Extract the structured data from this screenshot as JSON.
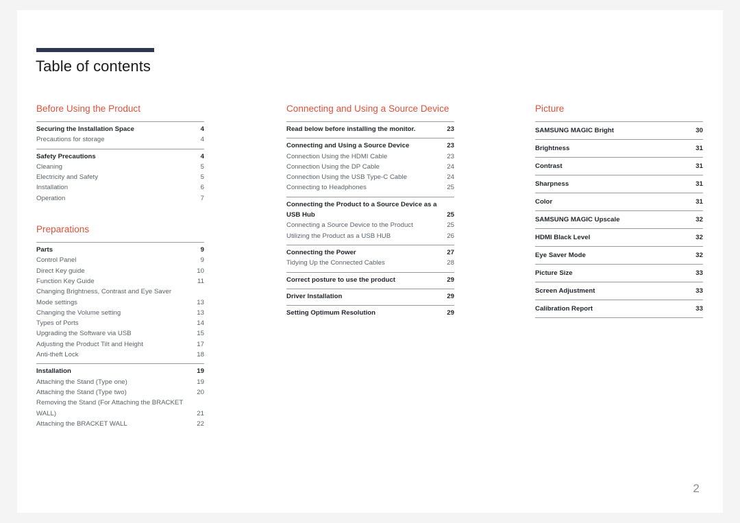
{
  "document": {
    "title": "Table of contents",
    "folio": "2",
    "accent_color": "#e0503a",
    "rule_color": "#2e3650"
  },
  "columns": [
    {
      "name": "column-left",
      "sections": [
        {
          "heading": "Before Using the Product",
          "groups": [
            {
              "entries": [
                {
                  "label": "Securing the Installation Space",
                  "page": "4",
                  "level": "main"
                },
                {
                  "label": "Precautions for storage",
                  "page": "4",
                  "level": "sub"
                }
              ]
            },
            {
              "entries": [
                {
                  "label": "Safety Precautions",
                  "page": "4",
                  "level": "main"
                },
                {
                  "label": "Cleaning",
                  "page": "5",
                  "level": "sub"
                },
                {
                  "label": "Electricity and Safety",
                  "page": "5",
                  "level": "sub"
                },
                {
                  "label": "Installation",
                  "page": "6",
                  "level": "sub"
                },
                {
                  "label": "Operation",
                  "page": "7",
                  "level": "sub"
                }
              ]
            }
          ]
        },
        {
          "heading": "Preparations",
          "groups": [
            {
              "entries": [
                {
                  "label": "Parts",
                  "page": "9",
                  "level": "main"
                },
                {
                  "label": "Control Panel",
                  "page": "9",
                  "level": "sub"
                },
                {
                  "label": "Direct Key guide",
                  "page": "10",
                  "level": "sub"
                },
                {
                  "label": "Function Key Guide",
                  "page": "11",
                  "level": "sub"
                },
                {
                  "label": "Changing Brightness, Contrast and Eye Saver Mode settings",
                  "page": "13",
                  "level": "sub"
                },
                {
                  "label": "Changing the Volume setting",
                  "page": "13",
                  "level": "sub"
                },
                {
                  "label": "Types of Ports",
                  "page": "14",
                  "level": "sub"
                },
                {
                  "label": "Upgrading the Software via USB",
                  "page": "15",
                  "level": "sub"
                },
                {
                  "label": "Adjusting the Product Tilt and Height",
                  "page": "17",
                  "level": "sub"
                },
                {
                  "label": "Anti-theft Lock",
                  "page": "18",
                  "level": "sub"
                }
              ]
            },
            {
              "entries": [
                {
                  "label": "Installation",
                  "page": "19",
                  "level": "main"
                },
                {
                  "label": "Attaching the Stand (Type one)",
                  "page": "19",
                  "level": "sub"
                },
                {
                  "label": "Attaching the Stand (Type two)",
                  "page": "20",
                  "level": "sub"
                },
                {
                  "label": "Removing the Stand (For Attaching the BRACKET WALL)",
                  "page": "21",
                  "level": "sub"
                },
                {
                  "label": "Attaching the BRACKET WALL",
                  "page": "22",
                  "level": "sub"
                }
              ]
            }
          ]
        }
      ]
    },
    {
      "name": "column-middle",
      "sections": [
        {
          "heading": "Connecting and Using a Source Device",
          "groups": [
            {
              "entries": [
                {
                  "label": "Read below before installing the monitor.",
                  "page": "23",
                  "level": "main"
                }
              ]
            },
            {
              "entries": [
                {
                  "label": "Connecting and Using a Source Device",
                  "page": "23",
                  "level": "main"
                },
                {
                  "label": "Connection Using the HDMI Cable",
                  "page": "23",
                  "level": "sub"
                },
                {
                  "label": "Connection Using the DP Cable",
                  "page": "24",
                  "level": "sub"
                },
                {
                  "label": "Connection Using the USB Type-C Cable",
                  "page": "24",
                  "level": "sub"
                },
                {
                  "label": "Connecting to Headphones",
                  "page": "25",
                  "level": "sub"
                }
              ]
            },
            {
              "entries": [
                {
                  "label": "Connecting the Product to a Source Device as a USB Hub",
                  "page": "25",
                  "level": "main"
                },
                {
                  "label": "Connecting a Source Device to the Product",
                  "page": "25",
                  "level": "sub"
                },
                {
                  "label": "Utilizing the Product as a USB HUB",
                  "page": "26",
                  "level": "sub"
                }
              ]
            },
            {
              "entries": [
                {
                  "label": "Connecting the Power",
                  "page": "27",
                  "level": "main"
                },
                {
                  "label": "Tidying Up the Connected Cables",
                  "page": "28",
                  "level": "sub"
                }
              ]
            },
            {
              "entries": [
                {
                  "label": "Correct posture to use the product",
                  "page": "29",
                  "level": "main"
                }
              ]
            },
            {
              "entries": [
                {
                  "label": "Driver Installation",
                  "page": "29",
                  "level": "main"
                }
              ]
            },
            {
              "entries": [
                {
                  "label": "Setting Optimum Resolution",
                  "page": "29",
                  "level": "main"
                }
              ]
            }
          ]
        }
      ]
    },
    {
      "name": "column-right",
      "sections": [
        {
          "heading": "Picture",
          "groups": [
            {
              "entries": [
                {
                  "label": "SAMSUNG MAGIC Bright",
                  "page": "30",
                  "level": "main"
                }
              ]
            },
            {
              "entries": [
                {
                  "label": "Brightness",
                  "page": "31",
                  "level": "main"
                }
              ]
            },
            {
              "entries": [
                {
                  "label": "Contrast",
                  "page": "31",
                  "level": "main"
                }
              ]
            },
            {
              "entries": [
                {
                  "label": "Sharpness",
                  "page": "31",
                  "level": "main"
                }
              ]
            },
            {
              "entries": [
                {
                  "label": "Color",
                  "page": "31",
                  "level": "main"
                }
              ]
            },
            {
              "entries": [
                {
                  "label": "SAMSUNG MAGIC Upscale",
                  "page": "32",
                  "level": "main"
                }
              ]
            },
            {
              "entries": [
                {
                  "label": "HDMI Black Level",
                  "page": "32",
                  "level": "main"
                }
              ]
            },
            {
              "entries": [
                {
                  "label": "Eye Saver Mode",
                  "page": "32",
                  "level": "main"
                }
              ]
            },
            {
              "entries": [
                {
                  "label": "Picture Size",
                  "page": "33",
                  "level": "main"
                }
              ]
            },
            {
              "entries": [
                {
                  "label": "Screen Adjustment",
                  "page": "33",
                  "level": "main"
                }
              ]
            },
            {
              "entries": [
                {
                  "label": "Calibration Report",
                  "page": "33",
                  "level": "main"
                }
              ]
            }
          ]
        }
      ]
    }
  ]
}
